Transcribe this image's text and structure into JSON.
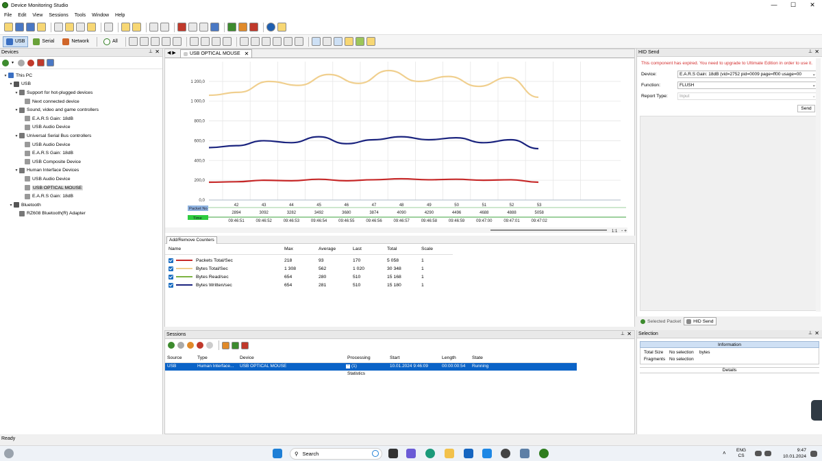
{
  "window": {
    "title": "Device Monitoring Studio",
    "minimize": "—",
    "maximize": "☐",
    "close": "✕"
  },
  "menu": [
    "File",
    "Edit",
    "View",
    "Sessions",
    "Tools",
    "Window",
    "Help"
  ],
  "filters": {
    "usb": "USB",
    "serial": "Serial",
    "network": "Network",
    "all": "All"
  },
  "devices_panel": {
    "title": "Devices",
    "tree": [
      {
        "label": "This PC",
        "level": 0,
        "arrow": "▾"
      },
      {
        "label": "USB",
        "level": 1,
        "arrow": "▾"
      },
      {
        "label": "Support for hot-plugged devices",
        "level": 2,
        "arrow": "▾"
      },
      {
        "label": "Next connected device",
        "level": 3,
        "arrow": ""
      },
      {
        "label": "Sound, video and game controllers",
        "level": 2,
        "arrow": "▾"
      },
      {
        "label": "E.A.R.S Gain: 18dB",
        "level": 3,
        "arrow": ""
      },
      {
        "label": "USB Audio Device",
        "level": 3,
        "arrow": ""
      },
      {
        "label": "Universal Serial Bus controllers",
        "level": 2,
        "arrow": "▾"
      },
      {
        "label": "USB Audio Device",
        "level": 3,
        "arrow": ""
      },
      {
        "label": "E.A.R.S Gain: 18dB",
        "level": 3,
        "arrow": ""
      },
      {
        "label": "USB Composite Device",
        "level": 3,
        "arrow": ""
      },
      {
        "label": "Human Interface Devices",
        "level": 2,
        "arrow": "▾"
      },
      {
        "label": "USB Audio Device",
        "level": 3,
        "arrow": ""
      },
      {
        "label": "USB OPTICAL MOUSE",
        "level": 3,
        "arrow": "",
        "selected": true
      },
      {
        "label": "E.A.R.S Gain: 18dB",
        "level": 3,
        "arrow": ""
      },
      {
        "label": "Bluetooth",
        "level": 1,
        "arrow": "▾"
      },
      {
        "label": "RZ608 Bluetooth(R) Adapter",
        "level": 2,
        "arrow": ""
      }
    ]
  },
  "document": {
    "tab": "USB OPTICAL MOUSE",
    "nav_arrows": "◀ ▶",
    "packet_label": "Packet No",
    "time_label": "Time",
    "zoom": "1:1",
    "zoom_out": "-",
    "zoom_in": "+",
    "graph_tab": "Add/Remove Counters"
  },
  "chart_data": {
    "type": "line",
    "ylim": [
      0,
      1400
    ],
    "yticks": [
      "0,0",
      "200,0",
      "400,0",
      "600,0",
      "800,0",
      "1 000,0",
      "1 200,0"
    ],
    "packet_numbers": [
      "42",
      "43",
      "44",
      "45",
      "46",
      "47",
      "48",
      "49",
      "50",
      "51",
      "52",
      "53"
    ],
    "packet_values": [
      "2894",
      "3092",
      "3282",
      "3492",
      "3680",
      "3874",
      "4090",
      "4290",
      "4496",
      "4688",
      "4888",
      "5058"
    ],
    "times": [
      "09:46:51",
      "09:46:52",
      "09:46:53",
      "09:46:54",
      "09:46:55",
      "09:46:56",
      "09:46:57",
      "09:46:58",
      "09:46:59",
      "09:47:00",
      "09:47:01",
      "09:47:02"
    ],
    "series": [
      {
        "name": "Bytes Total/Sec",
        "color": "#f0cf8e",
        "values": [
          1060,
          1090,
          1200,
          1160,
          1270,
          1180,
          1310,
          1200,
          1250,
          1150,
          1240,
          1040
        ]
      },
      {
        "name": "Bytes Written/sec",
        "color": "#1a237e",
        "values": [
          530,
          550,
          600,
          580,
          640,
          570,
          610,
          640,
          610,
          630,
          580,
          610,
          520
        ]
      },
      {
        "name": "Packets Total/Sec",
        "color": "#c62828",
        "values": [
          180,
          185,
          200,
          195,
          210,
          195,
          205,
          215,
          205,
          210,
          200,
          205,
          180
        ]
      }
    ]
  },
  "counters": {
    "headers": [
      "Name",
      "Max",
      "Average",
      "Last",
      "Total",
      "Scale"
    ],
    "rows": [
      {
        "name": "Packets Total/Sec",
        "color": "#c62828",
        "max": "218",
        "avg": "93",
        "last": "170",
        "total": "5 058",
        "scale": "1"
      },
      {
        "name": "Bytes Total/Sec",
        "color": "#f0cf8e",
        "max": "1 308",
        "avg": "562",
        "last": "1 020",
        "total": "30 348",
        "scale": "1"
      },
      {
        "name": "Bytes Read/sec",
        "color": "#7cb342",
        "max": "654",
        "avg": "280",
        "last": "510",
        "total": "15 168",
        "scale": "1"
      },
      {
        "name": "Bytes Written/sec",
        "color": "#1a237e",
        "max": "654",
        "avg": "281",
        "last": "510",
        "total": "15 180",
        "scale": "1"
      }
    ]
  },
  "hid_send": {
    "title": "HID Send",
    "warning": "This component has expired. You need to upgrade to Ultimate Edition in order to use it.",
    "device_label": "Device:",
    "device_value": "E.A.R.S Gain: 18dB (vid=2752 pid=0009 page=ff00 usage=00",
    "function_label": "Function:",
    "function_value": "FLUSH",
    "report_label": "Report Type:",
    "report_value": "Input",
    "send": "Send",
    "tab_selected_packet": "Selected Packet",
    "tab_hid_send": "HID Send"
  },
  "sessions": {
    "title": "Sessions",
    "headers": [
      "Source",
      "Type",
      "Device",
      "Processing",
      "Start",
      "Length",
      "State"
    ],
    "row": {
      "source": "USB",
      "type": "Human Interface...",
      "device": "USB OPTICAL MOUSE",
      "processing": "(1)",
      "start": "10.01.2024 9:46:09",
      "length": "00:00:00:54",
      "state": "Running"
    },
    "sub": "Statistics"
  },
  "selection": {
    "title": "Selection",
    "info": "Information",
    "total_size_label": "Total Size",
    "total_size_value": "No selection",
    "bytes": "bytes",
    "fragments_label": "Fragments",
    "fragments_value": "No selection",
    "details": "Details"
  },
  "status": "Ready",
  "taskbar": {
    "search": "Search",
    "lang1": "ENG",
    "lang2": "CS",
    "time": "9:47",
    "date": "10.01.2024"
  }
}
